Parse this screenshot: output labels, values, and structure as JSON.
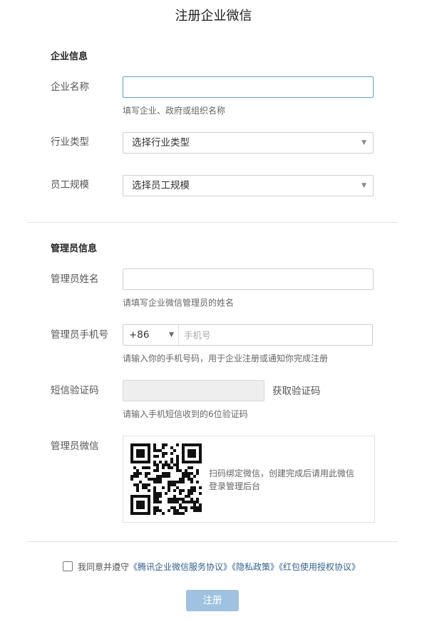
{
  "page": {
    "title": "注册企业微信"
  },
  "enterprise": {
    "section_title": "企业信息",
    "name": {
      "label": "企业名称",
      "value": "",
      "hint": "填写企业、政府或组织名称"
    },
    "industry": {
      "label": "行业类型",
      "selected": "选择行业类型"
    },
    "size": {
      "label": "员工规模",
      "selected": "选择员工规模"
    }
  },
  "admin": {
    "section_title": "管理员信息",
    "name": {
      "label": "管理员姓名",
      "value": "",
      "hint": "请填写企业微信管理员的姓名"
    },
    "phone": {
      "label": "管理员手机号",
      "country_code": "+86",
      "placeholder": "手机号",
      "hint": "请输入你的手机号码，用于企业注册或通知你完成注册"
    },
    "sms": {
      "label": "短信验证码",
      "value": "",
      "get_code_label": "获取验证码",
      "hint": "请输入手机短信收到的6位验证码"
    },
    "wechat": {
      "label": "管理员微信",
      "instruction_line1": "扫码绑定微信，创建完成后请用此微信",
      "instruction_line2": "登录管理后台"
    }
  },
  "agreement": {
    "checked": false,
    "prefix": "我同意并遵守",
    "links": [
      "《腾讯企业微信服务协议》",
      "《隐私政策》",
      "《红包使用授权协议》"
    ]
  },
  "submit_label": "注册",
  "colors": {
    "link": "#2f5f8f",
    "submit_bg": "#9ec2df",
    "focus_border": "#6fa6cd",
    "divider": "#e6e6e6"
  }
}
